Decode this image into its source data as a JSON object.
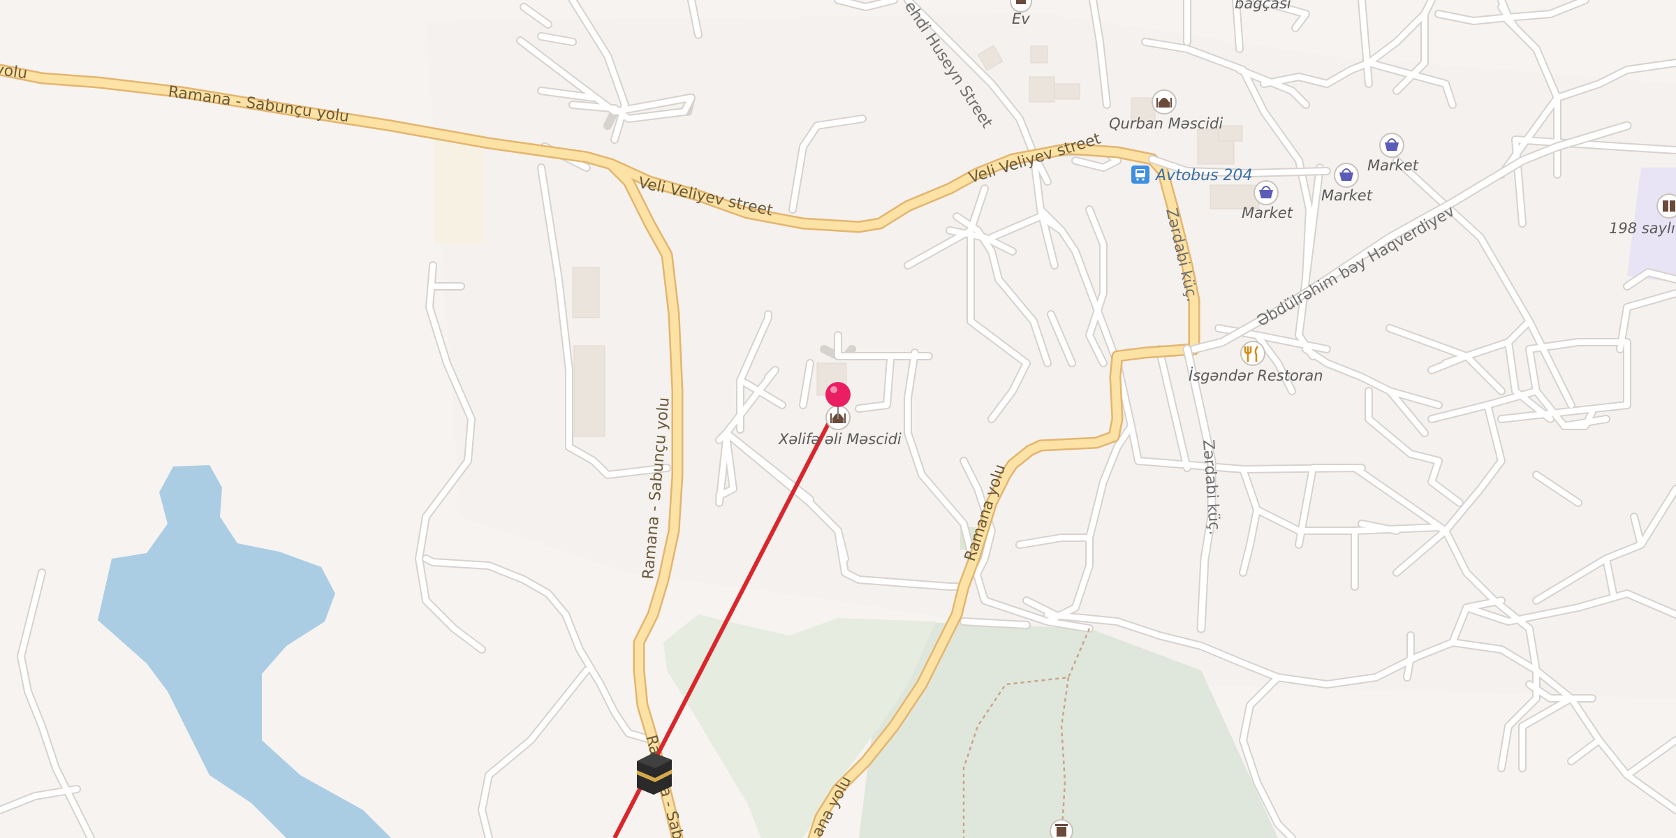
{
  "map": {
    "route_color": "#d9262c",
    "pin_color": "#e91e63",
    "water_color": "#abcde4",
    "forest_color": "#dfe5da",
    "park_color": "#e6ecdf",
    "roads": {
      "ramana_sabuncu_top": "Ramana - Sabunçu yolu",
      "ramana_sabuncu_top_left": "yolu",
      "veli_veliyev_1": "Veli Veliyev street",
      "veli_veliyev_2": "Veli Veliyev street",
      "ramana_sabuncu_vertical": "Ramana - Sabunçu yolu",
      "ramana_sabuncu_bottom": "Ramana - Sab",
      "ramana_yolu_mid": "Ramana yolu",
      "ramana_yolu_bottom": "ana yolu",
      "zardabi_top": "Zərdabi küç.",
      "zardabi_bottom": "Zərdabi küç.",
      "abdulrahim": "Əbdülrəhim bəy Haqverdiyev",
      "mehdi_huseyn": "ehdi Huseyn Street"
    },
    "pois": {
      "ev": "Ev",
      "bagcasi": "bağçası",
      "qurban_mescidi": "Qurban Məscidi",
      "avtobus": "Avtobus 204",
      "market_1": "Market",
      "market_2": "Market",
      "market_3": "Market",
      "school": "198 saylı",
      "restoran": "İsgəndər Restoran",
      "xelife_mescidi": "Xəlifə əli Məscidi"
    },
    "icons": {
      "mosque": "mosque-icon",
      "bus": "bus-stop-icon",
      "market": "shopping-basket-icon",
      "restaurant": "fork-knife-icon",
      "school": "book-icon",
      "kaaba": "kaaba-icon",
      "pin": "location-pin-icon",
      "trash": "waste-basket-icon",
      "home": "home-icon"
    }
  }
}
